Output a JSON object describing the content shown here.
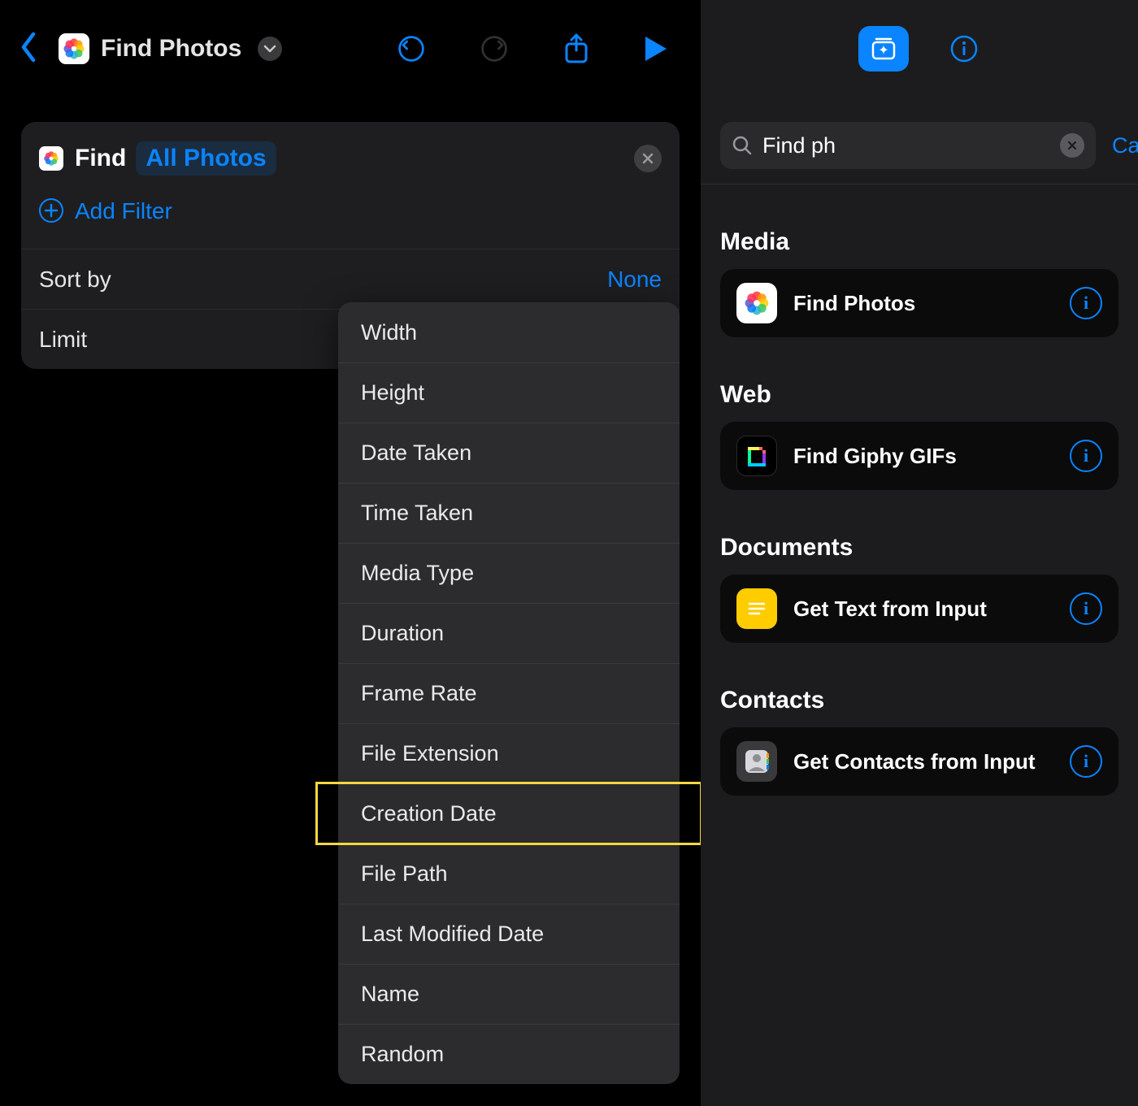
{
  "left": {
    "title": "Find Photos",
    "card": {
      "find_label": "Find",
      "chip": "All Photos",
      "add_filter": "Add Filter",
      "sort_by": "Sort by",
      "sort_value": "None",
      "limit": "Limit"
    },
    "popup": [
      "Width",
      "Height",
      "Date Taken",
      "Time Taken",
      "Media Type",
      "Duration",
      "Frame Rate",
      "File Extension",
      "Creation Date",
      "File Path",
      "Last Modified Date",
      "Name",
      "Random"
    ],
    "highlighted_index": 8
  },
  "right": {
    "search_value": "Find ph",
    "cancel": "Cancel",
    "sections": [
      {
        "title": "Media",
        "item": "Find Photos",
        "icon": "photos"
      },
      {
        "title": "Web",
        "item": "Find Giphy GIFs",
        "icon": "giphy"
      },
      {
        "title": "Documents",
        "item": "Get Text from Input",
        "icon": "text"
      },
      {
        "title": "Contacts",
        "item": "Get Contacts from Input",
        "icon": "contacts"
      }
    ]
  }
}
